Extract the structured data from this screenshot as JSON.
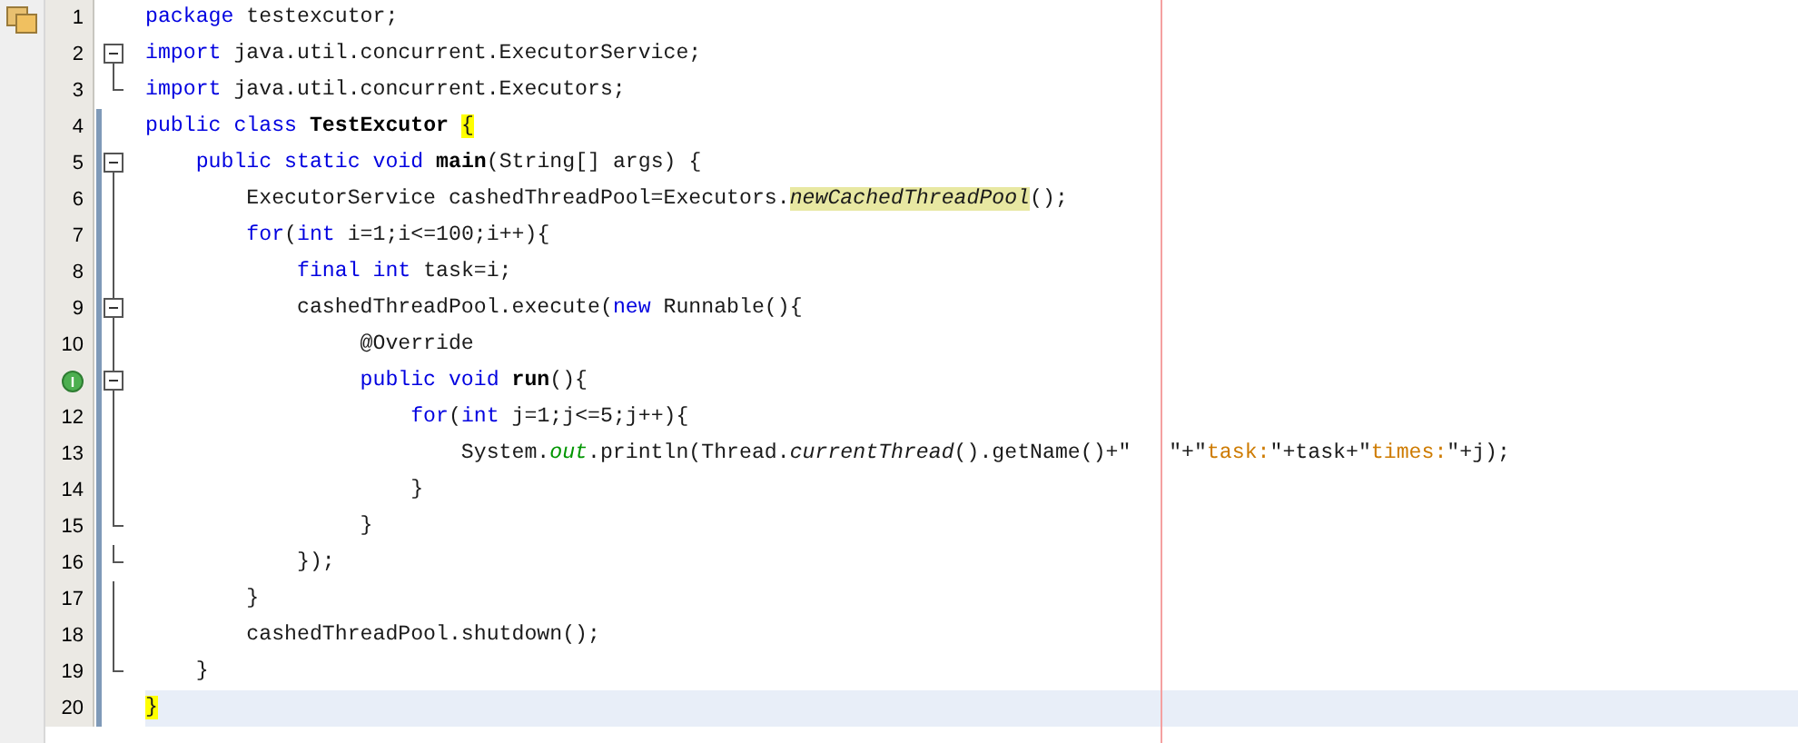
{
  "editor": {
    "lines": [
      {
        "number": "1",
        "collapsible": false,
        "in_block": false,
        "block_end": false,
        "scope": false,
        "current": false,
        "tokens": [
          {
            "kind": "kw",
            "text": "package"
          },
          {
            "kind": "plain",
            "text": " testexcutor;"
          }
        ]
      },
      {
        "number": "2",
        "collapsible": true,
        "in_block": false,
        "block_end": false,
        "scope": false,
        "current": false,
        "tokens": [
          {
            "kind": "kw",
            "text": "import"
          },
          {
            "kind": "plain",
            "text": " java.util.concurrent.ExecutorService;"
          }
        ]
      },
      {
        "number": "3",
        "collapsible": false,
        "in_block": false,
        "block_end": true,
        "scope": false,
        "current": false,
        "tokens": [
          {
            "kind": "kw",
            "text": "import"
          },
          {
            "kind": "plain",
            "text": " java.util.concurrent.Executors;"
          }
        ]
      },
      {
        "number": "4",
        "collapsible": false,
        "in_block": false,
        "block_end": false,
        "scope": true,
        "current": false,
        "tokens": [
          {
            "kind": "kw",
            "text": "public class "
          },
          {
            "kind": "bold",
            "text": "TestExcutor "
          },
          {
            "kind": "match",
            "text": "{"
          }
        ]
      },
      {
        "number": "5",
        "collapsible": true,
        "in_block": false,
        "block_end": false,
        "scope": true,
        "current": false,
        "tokens": [
          {
            "kind": "kw",
            "text": "    public static void "
          },
          {
            "kind": "bold",
            "text": "main"
          },
          {
            "kind": "plain",
            "text": "(String[] args) {"
          }
        ]
      },
      {
        "number": "6",
        "collapsible": false,
        "in_block": true,
        "block_end": false,
        "scope": true,
        "current": false,
        "tokens": [
          {
            "kind": "plain",
            "text": "        ExecutorService cashedThreadPool=Executors."
          },
          {
            "kind": "mark",
            "text": "newCachedThreadPool"
          },
          {
            "kind": "plain",
            "text": "();"
          }
        ]
      },
      {
        "number": "7",
        "collapsible": false,
        "in_block": true,
        "block_end": false,
        "scope": true,
        "current": false,
        "tokens": [
          {
            "kind": "kw",
            "text": "        for"
          },
          {
            "kind": "plain",
            "text": "("
          },
          {
            "kind": "kw",
            "text": "int"
          },
          {
            "kind": "plain",
            "text": " i=1;i<=100;i++){"
          }
        ]
      },
      {
        "number": "8",
        "collapsible": false,
        "in_block": true,
        "block_end": false,
        "scope": true,
        "current": false,
        "tokens": [
          {
            "kind": "kw",
            "text": "            final int"
          },
          {
            "kind": "plain",
            "text": " task=i;"
          }
        ]
      },
      {
        "number": "9",
        "collapsible": true,
        "in_block": true,
        "block_end": false,
        "scope": true,
        "current": false,
        "tokens": [
          {
            "kind": "plain",
            "text": "            cashedThreadPool.execute("
          },
          {
            "kind": "kw",
            "text": "new"
          },
          {
            "kind": "plain",
            "text": " Runnable(){"
          }
        ]
      },
      {
        "number": "10",
        "collapsible": false,
        "in_block": true,
        "block_end": false,
        "scope": true,
        "current": false,
        "tokens": [
          {
            "kind": "plain",
            "text": "                 @Override"
          }
        ]
      },
      {
        "badge": "I",
        "collapsible": true,
        "in_block": true,
        "block_end": false,
        "scope": true,
        "current": false,
        "tokens": [
          {
            "kind": "kw",
            "text": "                 public void "
          },
          {
            "kind": "bold",
            "text": "run"
          },
          {
            "kind": "plain",
            "text": "(){"
          }
        ]
      },
      {
        "number": "12",
        "collapsible": false,
        "in_block": true,
        "block_end": false,
        "scope": true,
        "current": false,
        "tokens": [
          {
            "kind": "kw",
            "text": "                     for"
          },
          {
            "kind": "plain",
            "text": "("
          },
          {
            "kind": "kw",
            "text": "int"
          },
          {
            "kind": "plain",
            "text": " j=1;j<=5;j++){"
          }
        ]
      },
      {
        "number": "13",
        "collapsible": false,
        "in_block": true,
        "block_end": false,
        "scope": true,
        "current": false,
        "tokens": [
          {
            "kind": "plain",
            "text": "                         System."
          },
          {
            "kind": "field",
            "text": "out"
          },
          {
            "kind": "plain",
            "text": ".println(Thread."
          },
          {
            "kind": "italic",
            "text": "currentThread"
          },
          {
            "kind": "plain",
            "text": "().getName()+\"   \"+\""
          },
          {
            "kind": "string",
            "text": "task:"
          },
          {
            "kind": "plain",
            "text": "\"+task+\""
          },
          {
            "kind": "string",
            "text": "times:"
          },
          {
            "kind": "plain",
            "text": "\"+j);"
          }
        ]
      },
      {
        "number": "14",
        "collapsible": false,
        "in_block": true,
        "block_end": false,
        "scope": true,
        "current": false,
        "tokens": [
          {
            "kind": "plain",
            "text": "                     }"
          }
        ]
      },
      {
        "number": "15",
        "collapsible": false,
        "in_block": true,
        "block_end": true,
        "scope": true,
        "current": false,
        "tokens": [
          {
            "kind": "plain",
            "text": "                 }"
          }
        ]
      },
      {
        "number": "16",
        "collapsible": false,
        "in_block": true,
        "block_end": true,
        "scope": true,
        "current": false,
        "tokens": [
          {
            "kind": "plain",
            "text": "            });"
          }
        ]
      },
      {
        "number": "17",
        "collapsible": false,
        "in_block": true,
        "block_end": false,
        "scope": true,
        "current": false,
        "tokens": [
          {
            "kind": "plain",
            "text": "        }"
          }
        ]
      },
      {
        "number": "18",
        "collapsible": false,
        "in_block": true,
        "block_end": false,
        "scope": true,
        "current": false,
        "tokens": [
          {
            "kind": "plain",
            "text": "        cashedThreadPool.shutdown();"
          }
        ]
      },
      {
        "number": "19",
        "collapsible": false,
        "in_block": true,
        "block_end": true,
        "scope": true,
        "current": false,
        "tokens": [
          {
            "kind": "plain",
            "text": "    }"
          }
        ]
      },
      {
        "number": "20",
        "collapsible": false,
        "in_block": false,
        "block_end": false,
        "scope": true,
        "current": true,
        "tokens": [
          {
            "kind": "match",
            "text": "}"
          }
        ]
      }
    ]
  }
}
